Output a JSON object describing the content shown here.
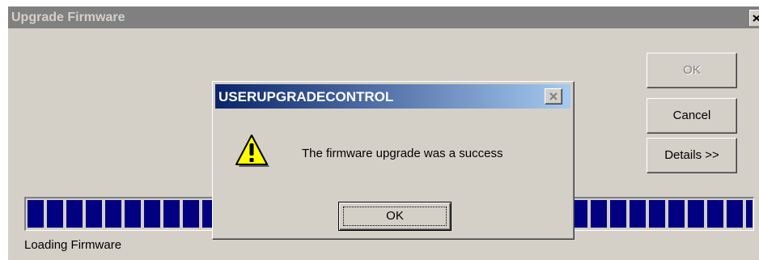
{
  "main_window": {
    "title": "Upgrade Firmware",
    "close_label": "×",
    "buttons": {
      "ok": "OK",
      "cancel": "Cancel",
      "details": "Details >>"
    },
    "progress": {
      "fraction": 1.0,
      "color": "#000080"
    },
    "status_text": "Loading Firmware"
  },
  "dialog": {
    "title": "USERUPGRADECONTROL",
    "icon": "warning-icon",
    "message": "The firmware upgrade was a success",
    "ok_label": "OK"
  },
  "colors": {
    "window_bg": "#d4d0c8",
    "inactive_title": "#808080",
    "active_title_start": "#0a246a",
    "active_title_end": "#a6caf0",
    "warning_yellow": "#ffff00"
  }
}
